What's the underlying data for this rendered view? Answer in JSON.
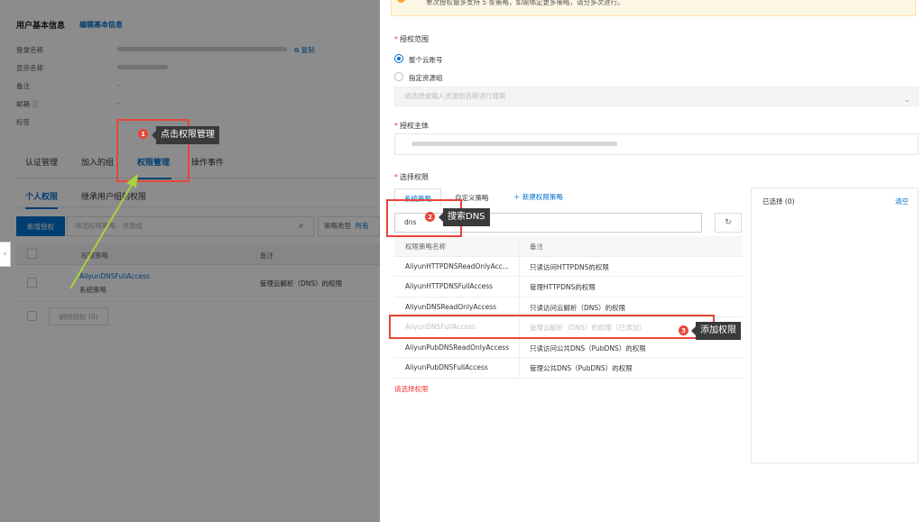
{
  "colors": {
    "accent": "#0070cc",
    "annotation": "#e8463a",
    "arrow": "#a6d23a",
    "error": "#e33333"
  },
  "left": {
    "section_title": "用户基本信息",
    "edit_link": "编辑基本信息",
    "fields": [
      {
        "label": "登录名称",
        "value": ""
      },
      {
        "label": "显示名称",
        "value": ""
      },
      {
        "label": "备注",
        "value": "-"
      },
      {
        "label": "邮箱 ⓘ",
        "value": "-"
      },
      {
        "label": "标签",
        "value": ""
      }
    ],
    "copy_link": "复制",
    "tabs": [
      "认证管理",
      "加入的组",
      "权限管理",
      "操作事件"
    ],
    "subtabs": [
      "个人权限",
      "继承用户组的权限"
    ],
    "add_button": "新增授权",
    "filter_placeholder": "筛选权限策略、资源组",
    "type_select_label": "策略类型",
    "type_select_value": "所有",
    "table_headers": [
      "权限策略",
      "备注"
    ],
    "table_row": {
      "name": "AliyunDNSFullAccess",
      "type": "系统策略",
      "note": "管理云解析（DNS）的权限"
    },
    "revoke_button": "解除授权 (0)"
  },
  "drawer": {
    "notice_line": "单次授权最多支持 5 条策略，如需绑定更多策略，请分多次进行。",
    "scope_label": "授权范围",
    "scope_options": [
      "整个云账号",
      "指定资源组"
    ],
    "rg_placeholder": "请选择或输入资源组名称进行搜索",
    "principal_label": "授权主体",
    "select_label": "选择权限",
    "policy_tabs": [
      "系统策略",
      "自定义策略"
    ],
    "new_policy": "新建权限策略",
    "search_value": "dns",
    "table_headers": [
      "权限策略名称",
      "备注"
    ],
    "policies": [
      {
        "name": "AliyunHTTPDNSReadOnlyAcc...",
        "note": "只读访问HTTPDNS的权限"
      },
      {
        "name": "AliyunHTTPDNSFullAccess",
        "note": "管理HTTPDNS的权限"
      },
      {
        "name": "AliyunDNSReadOnlyAccess",
        "note": "只读访问云解析（DNS）的权限"
      },
      {
        "name": "AliyunDNSFullAccess",
        "note": "管理云解析（DNS）的权限（已添加）"
      },
      {
        "name": "AliyunPubDNSReadOnlyAccess",
        "note": "只读访问公共DNS（PubDNS）的权限"
      },
      {
        "name": "AliyunPubDNSFullAccess",
        "note": "管理公共DNS（PubDNS）的权限"
      }
    ],
    "error_text": "请选择权限",
    "selected_title": "已选择 (0)",
    "clear_link": "清空"
  },
  "annotations": [
    {
      "num": "1",
      "text": "点击权限管理"
    },
    {
      "num": "2",
      "text": "搜索DNS"
    },
    {
      "num": "3",
      "text": "添加权限"
    }
  ]
}
